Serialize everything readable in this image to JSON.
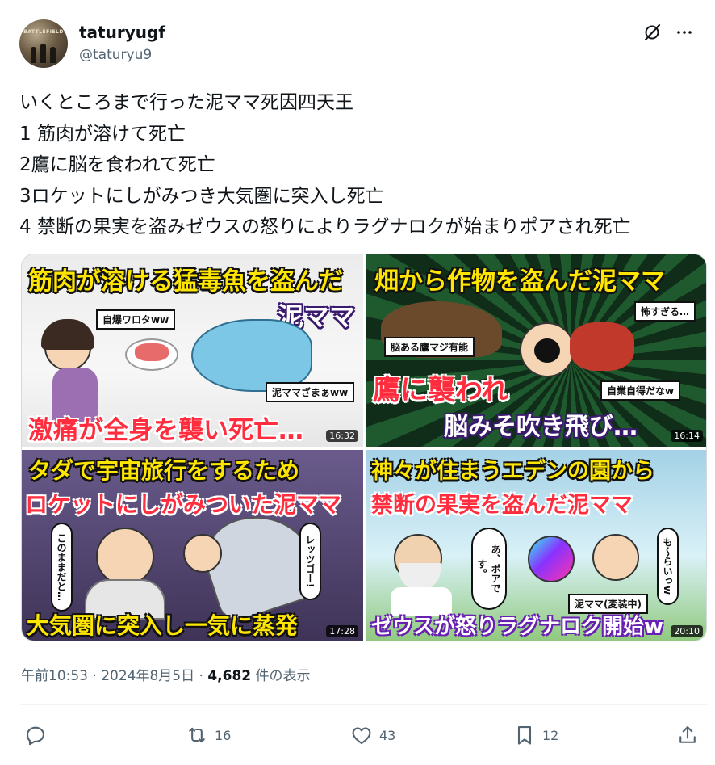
{
  "user": {
    "display_name": "taturyugf",
    "handle": "@taturyu9",
    "avatar_text": "BATTLEFIELD"
  },
  "tweet": {
    "lines": [
      "いくところまで行った泥ママ死因四天王",
      "1 筋肉が溶けて死亡",
      "2鷹に脳を食われて死亡",
      "3ロケットにしがみつき大気圏に突入し死亡",
      "4 禁断の果実を盗みゼウスの怒りによりラグナロクが始まりポアされ死亡"
    ]
  },
  "thumbnails": [
    {
      "title_a": "筋肉が溶ける猛毒魚を盗んだ",
      "title_b": "泥ママ",
      "bubble_1": "自爆ワロタww",
      "bubble_2": "泥ママざまぁww",
      "bottom": "激痛が全身を襲い死亡…",
      "duration": "16:32"
    },
    {
      "title": "畑から作物を盗んだ泥ママ",
      "bubble_1": "怖すぎる…",
      "bubble_2": "脳ある鷹マジ有能",
      "bubble_3": "自業自得だなw",
      "mid": "鷹に襲われ",
      "bottom": "脳みそ吹き飛び…",
      "duration": "16:14"
    },
    {
      "title_a": "タダで宇宙旅行をするため",
      "title_b": "ロケットにしがみついた泥ママ",
      "vbubble_1": "このままだと…",
      "vbubble_2": "レッツゴー!",
      "bottom": "大気圏に突入し一気に蒸発",
      "duration": "17:28"
    },
    {
      "title_a": "神々が住まうエデンの園から",
      "title_b": "禁断の果実を盗んだ泥ママ",
      "vbubble_1": "あ、ポアです。",
      "vbubble_2": "も～らいっw",
      "bubble_1": "泥ママ(変装中)",
      "bottom": "ゼウスが怒りラグナロク開始w",
      "duration": "20:10"
    }
  ],
  "meta": {
    "time": "午前10:53",
    "date": "2024年8月5日",
    "sep": "·",
    "views_count": "4,682",
    "views_label": "件の表示"
  },
  "actions": {
    "retweets": "16",
    "likes": "43",
    "bookmarks": "12"
  }
}
